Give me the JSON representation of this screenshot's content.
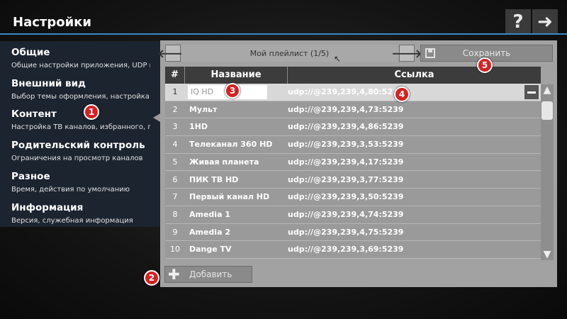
{
  "header": {
    "title": "Настройки",
    "help_icon": "?",
    "forward_icon": "➜"
  },
  "sidebar": {
    "items": [
      {
        "title": "Общие",
        "subtitle": "Общие настройки приложения, UDP прок"
      },
      {
        "title": "Внешний вид",
        "subtitle": "Выбор темы оформления, настройка инт"
      },
      {
        "title": "Контент",
        "subtitle": "Настройка ТВ каналов, избранного, плей"
      },
      {
        "title": "Родительский контроль",
        "subtitle": "Ограничения на просмотр каналов"
      },
      {
        "title": "Разное",
        "subtitle": "Время, действия по умолчанию"
      },
      {
        "title": "Информация",
        "subtitle": "Версия, служебная информация"
      }
    ]
  },
  "playlist": {
    "name": "Мой плейлист (1/5)",
    "prev_icon": "🡐",
    "next_icon": "🡒",
    "save_label": "Сохранить"
  },
  "table": {
    "headers": {
      "num": "#",
      "name": "Название",
      "link": "Ссылка"
    },
    "rows": [
      {
        "num": "1",
        "name": "IQ HD",
        "link": "udp://@239,239,4,80:5239"
      },
      {
        "num": "2",
        "name": "Мульт",
        "link": "udp://@239,239,4,73:5239"
      },
      {
        "num": "3",
        "name": "1HD",
        "link": "udp://@239,239,4,86:5239"
      },
      {
        "num": "4",
        "name": "Телеканал 360 HD",
        "link": "udp://@239,239,3,53:5239"
      },
      {
        "num": "5",
        "name": "Живая планета",
        "link": "udp://@239,239,4,17:5239"
      },
      {
        "num": "6",
        "name": "ПИК ТВ HD",
        "link": "udp://@239,239,3,77:5239"
      },
      {
        "num": "7",
        "name": "Первый канал HD",
        "link": "udp://@239,239,3,50:5239"
      },
      {
        "num": "8",
        "name": "Amedia 1",
        "link": "udp://@239,239,4,74:5239"
      },
      {
        "num": "9",
        "name": "Amedia 2",
        "link": "udp://@239,239,4,75:5239"
      },
      {
        "num": "10",
        "name": "Dange TV",
        "link": "udp://@239,239,3,69:5239"
      }
    ]
  },
  "add_label": "Добавить",
  "badges": [
    "1",
    "2",
    "3",
    "4",
    "5"
  ],
  "colors": {
    "accent": "#3a88c8",
    "badge": "#d82020",
    "panel": "#a2a2a2",
    "sidebar": "#1c2430"
  }
}
